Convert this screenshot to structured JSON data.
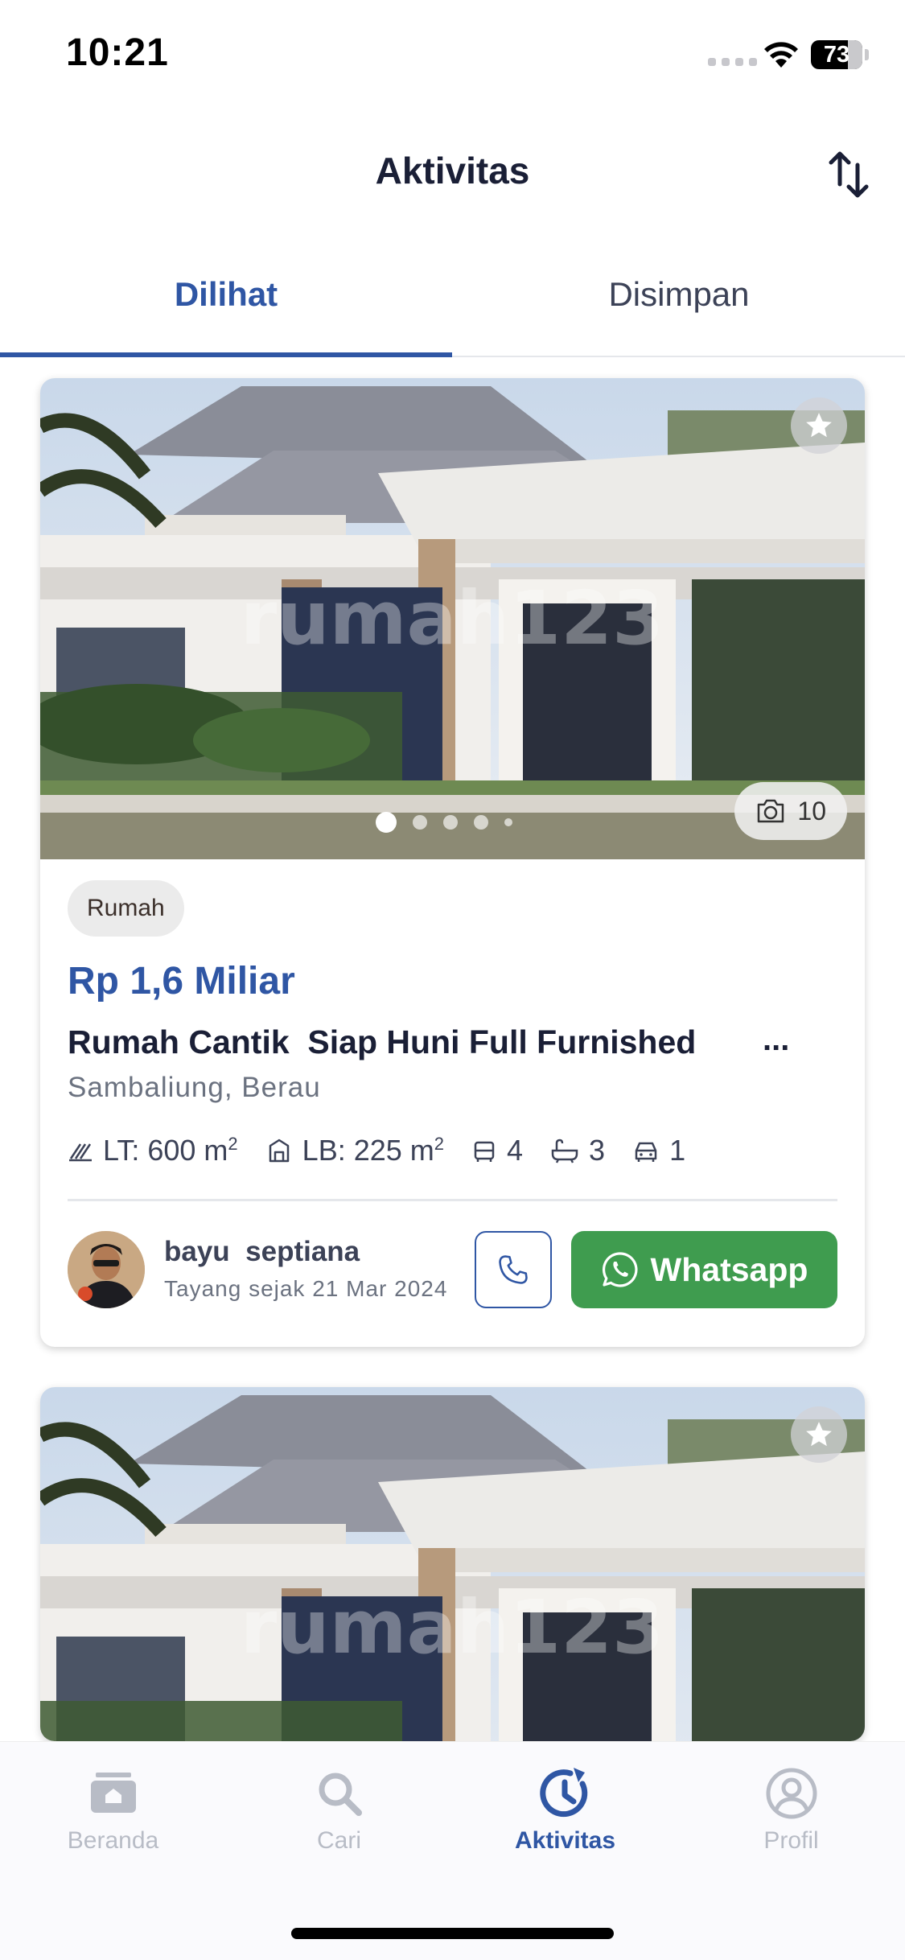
{
  "status_bar": {
    "time": "10:21",
    "battery": "73"
  },
  "header": {
    "title": "Aktivitas"
  },
  "tabs": [
    {
      "label": "Dilihat",
      "active": true
    },
    {
      "label": "Disimpan",
      "active": false
    }
  ],
  "listings": [
    {
      "watermark": "rumah123",
      "photo_count": "10",
      "carousel_active_index": 0,
      "property_type": "Rumah",
      "price": "Rp 1,6 Miliar",
      "title": "Rumah Cantik  Siap Huni Full Furnished",
      "title_more": "...",
      "location": "Sambaliung, Berau",
      "specs": {
        "land_area": "LT: 600 m",
        "building_area": "LB: 225 m",
        "area_unit_sup": "2",
        "bedrooms": "4",
        "bathrooms": "3",
        "garage": "1"
      },
      "agent": {
        "name": "bayu  septiana",
        "since": "Tayang sejak 21 Mar 2024"
      },
      "whatsapp_label": "Whatsapp"
    },
    {
      "watermark": "rumah123"
    }
  ],
  "bottom_nav": [
    {
      "label": "Beranda",
      "icon": "home-icon",
      "active": false
    },
    {
      "label": "Cari",
      "icon": "search-icon",
      "active": false
    },
    {
      "label": "Aktivitas",
      "icon": "activity-history-icon",
      "active": true
    },
    {
      "label": "Profil",
      "icon": "profile-icon",
      "active": false
    }
  ],
  "colors": {
    "primary": "#2f56a4",
    "whatsapp": "#3f9c4f",
    "text": "#1a1f36",
    "muted": "#6b7280"
  }
}
